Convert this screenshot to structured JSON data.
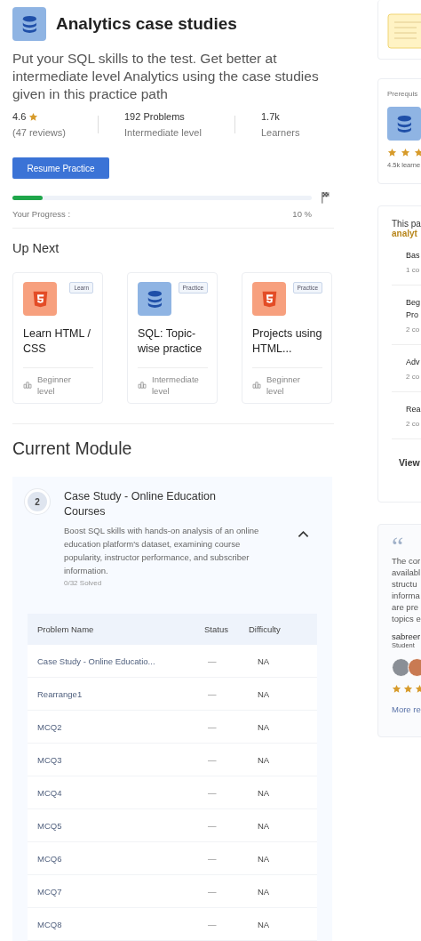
{
  "header": {
    "title": "Analytics case studies",
    "description": "Put your SQL skills to the test. Get better at intermediate level Analytics using the case studies given in this practice path"
  },
  "stats": [
    {
      "value": "4.6",
      "label": "(47 reviews)",
      "kind": "rating"
    },
    {
      "value": "192 Problems",
      "label": "Intermediate level",
      "kind": "plain"
    },
    {
      "value": "1.7k",
      "label": "Learners",
      "kind": "plain"
    }
  ],
  "resume_button": "Resume Practice",
  "progress": {
    "level": 0.1,
    "label": "Your Progress :",
    "reading": "10 %"
  },
  "up_next": {
    "title": "Up Next",
    "cards": [
      {
        "kind": "html",
        "tag": "Learn",
        "title": "Learn HTML / CSS",
        "level": "Beginner level"
      },
      {
        "kind": "database",
        "tag": "Practice",
        "title": "SQL: Topic-wise practice",
        "level": "Intermediate level"
      },
      {
        "kind": "html",
        "tag": "Practice",
        "title": "Projects using HTML...",
        "level": "Beginner level"
      }
    ]
  },
  "current_module": {
    "title": "Current Module",
    "number": "2",
    "name": "Case Study - Online Education Courses",
    "description": "Boost SQL skills with hands-on analysis of an online education platform's dataset, examining course popularity, instructor performance, and subscriber information.",
    "solved": "0/32 Solved",
    "expanded": true,
    "table": {
      "columns": [
        "Problem Name",
        "Status",
        "Difficulty"
      ],
      "rows": [
        [
          "Case Study - Online Educatio...",
          "—",
          "NA"
        ],
        [
          "Rearrange1",
          "—",
          "NA"
        ],
        [
          "MCQ2",
          "—",
          "NA"
        ],
        [
          "MCQ3",
          "—",
          "NA"
        ],
        [
          "MCQ4",
          "—",
          "NA"
        ],
        [
          "MCQ5",
          "—",
          "NA"
        ],
        [
          "MCQ6",
          "—",
          "NA"
        ],
        [
          "MCQ7",
          "—",
          "NA"
        ],
        [
          "MCQ8",
          "—",
          "NA"
        ]
      ]
    }
  },
  "sidebar": {
    "prerequisite": {
      "label": "Prerequis",
      "stars": 3,
      "learners": "4.5k learne"
    },
    "path": {
      "intro": "This pa",
      "highlight": "analyt",
      "items": [
        {
          "title": [
            "Bas"
          ],
          "count": "1 co"
        },
        {
          "title": [
            "Beg",
            "Pro"
          ],
          "count": "2 co"
        },
        {
          "title": [
            "Adv"
          ],
          "count": "2 co"
        },
        {
          "title": [
            "Rea"
          ],
          "count": "2 co"
        }
      ],
      "link": "View"
    },
    "review": {
      "quote_mark": "“",
      "lines": [
        "The cor",
        "availabl",
        "structu",
        "informa",
        "are pre",
        "topics e"
      ],
      "author": "sabreer",
      "role": "Student",
      "stars": 3,
      "link": "More re"
    }
  }
}
